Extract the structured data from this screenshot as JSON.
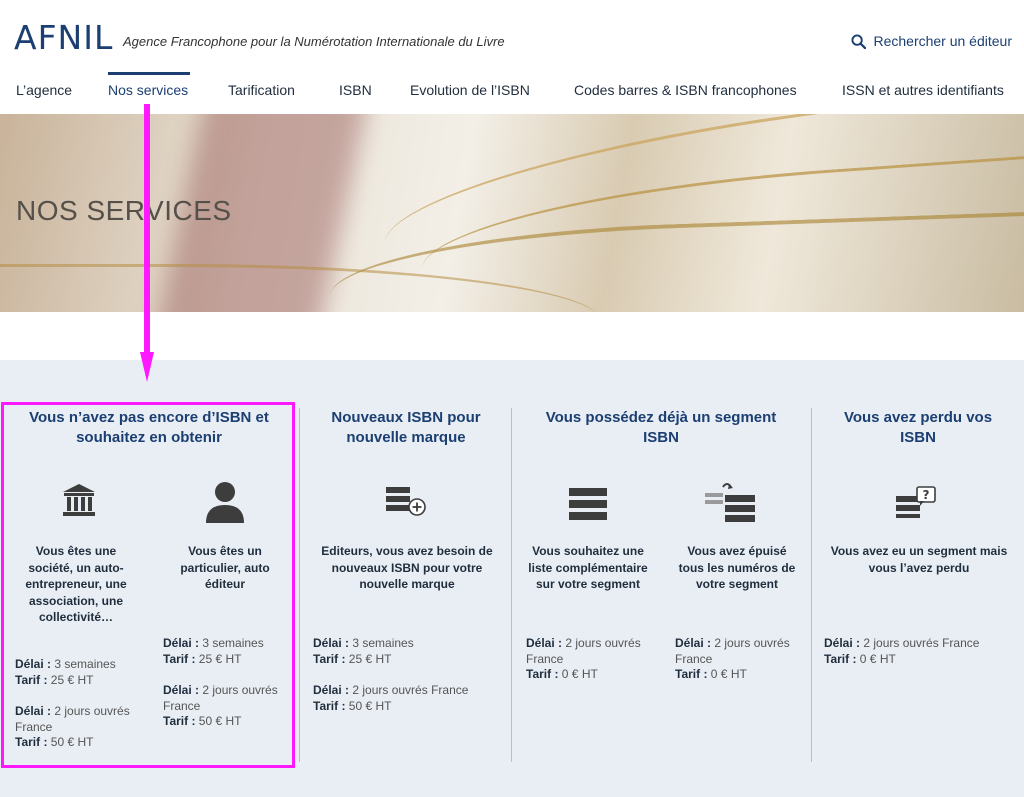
{
  "header": {
    "logo": "AFNIL",
    "tagline": "Agence Francophone pour la Numérotation Internationale du Livre",
    "search_label": "Rechercher un éditeur"
  },
  "nav": {
    "items": [
      {
        "label": "L’agence"
      },
      {
        "label": "Nos services"
      },
      {
        "label": "Tarification"
      },
      {
        "label": "ISBN"
      },
      {
        "label": "Evolution de l’ISBN"
      },
      {
        "label": "Codes barres & ISBN francophones"
      },
      {
        "label": "ISSN et autres identifiants"
      }
    ]
  },
  "hero": {
    "title": "NOS SERVICES"
  },
  "services": [
    {
      "title": "Vous n’avez pas encore d’ISBN et souhaitez en obtenir",
      "subs": [
        {
          "icon": "institution-icon",
          "desc": "Vous êtes une société, un auto-entrepreneur, une association, une collectivité…",
          "lines": [
            {
              "label": "Délai :",
              "value": "3 semaines"
            },
            {
              "label": "Tarif :",
              "value": "25 € HT"
            },
            {
              "label": "Délai :",
              "value": "2 jours ouvrés France"
            },
            {
              "label": "Tarif :",
              "value": "50 € HT"
            }
          ]
        },
        {
          "icon": "person-icon",
          "desc": "Vous êtes un particulier, auto éditeur",
          "lines": [
            {
              "label": "Délai :",
              "value": "3 semaines"
            },
            {
              "label": "Tarif :",
              "value": "25 € HT"
            },
            {
              "label": "Délai :",
              "value": "2 jours ouvrés France"
            },
            {
              "label": "Tarif :",
              "value": "50 € HT"
            }
          ]
        }
      ]
    },
    {
      "title": "Nouveaux ISBN pour nouvelle marque",
      "subs": [
        {
          "icon": "stack-add-icon",
          "desc": "Editeurs, vous avez besoin de nouveaux ISBN pour votre nouvelle marque",
          "lines": [
            {
              "label": "Délai :",
              "value": "3 semaines"
            },
            {
              "label": "Tarif :",
              "value": "25 € HT"
            },
            {
              "label": "Délai :",
              "value": "2 jours ouvrés France"
            },
            {
              "label": "Tarif :",
              "value": "50 € HT"
            }
          ]
        }
      ]
    },
    {
      "title": "Vous possédez déjà un segment ISBN",
      "subs": [
        {
          "icon": "stack-icon",
          "desc": "Vous souhaitez une liste complémentaire sur votre segment",
          "lines": [
            {
              "label": "Délai :",
              "value": "2 jours ouvrés France"
            },
            {
              "label": "Tarif :",
              "value": "0 € HT"
            }
          ]
        },
        {
          "icon": "stack-refill-icon",
          "desc": "Vous avez épuisé tous les numéros de votre segment",
          "lines": [
            {
              "label": "Délai :",
              "value": "2 jours ouvrés France"
            },
            {
              "label": "Tarif :",
              "value": "0 € HT"
            }
          ]
        }
      ]
    },
    {
      "title": "Vous avez perdu vos ISBN",
      "subs": [
        {
          "icon": "stack-question-icon",
          "desc": "Vous avez eu un segment mais vous l’avez perdu",
          "lines": [
            {
              "label": "Délai :",
              "value": "2 jours ouvrés France"
            },
            {
              "label": "Tarif :",
              "value": "0 € HT"
            }
          ]
        }
      ]
    }
  ],
  "colors": {
    "brand": "#1b3f72",
    "services_bg": "#e9eef4",
    "annotation": "#ff19ff"
  }
}
